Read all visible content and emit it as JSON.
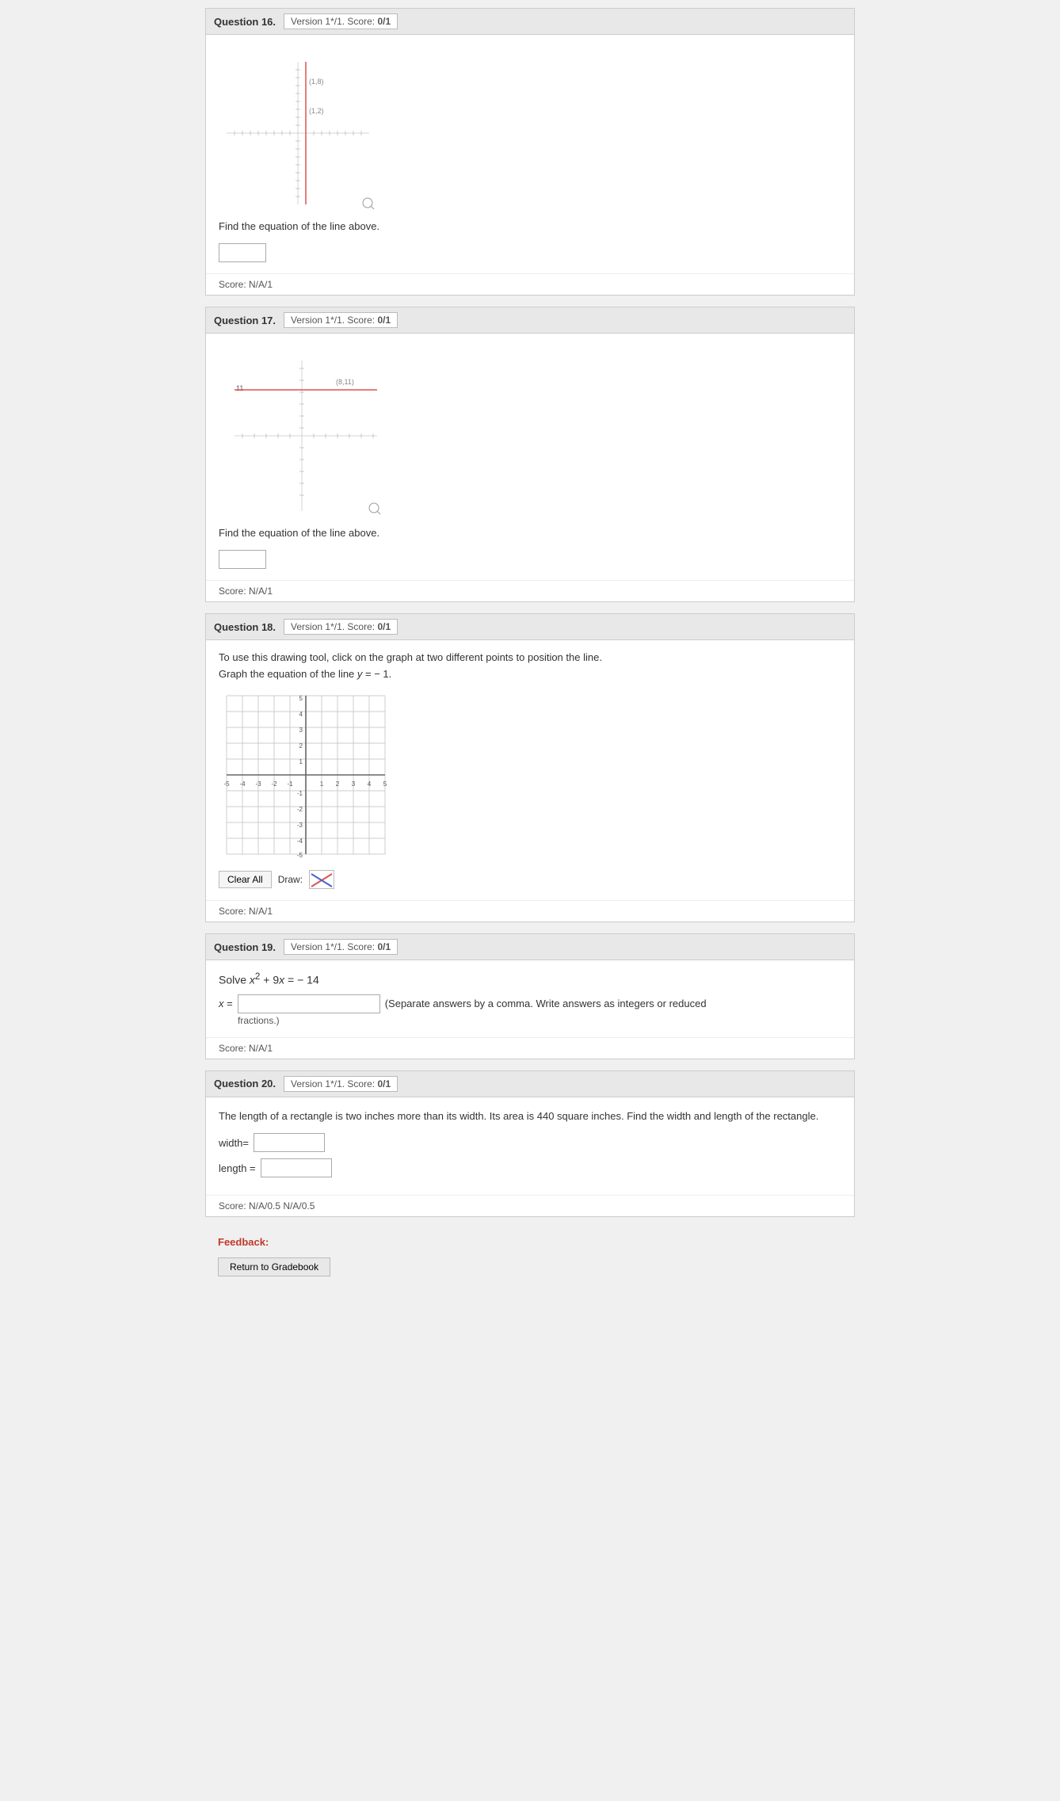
{
  "questions": [
    {
      "id": "q16",
      "number": "Question 16.",
      "version": "Version 1*/1.",
      "score_label": "Score:",
      "score_value": "0/1",
      "type": "find_equation",
      "instruction": "Find the equation of the line above.",
      "graph": {
        "type": "vertical_line",
        "label1": "(1,8)",
        "label2": "(1,2)"
      },
      "footer": "Score: N/A/1"
    },
    {
      "id": "q17",
      "number": "Question 17.",
      "version": "Version 1*/1.",
      "score_label": "Score:",
      "score_value": "0/1",
      "type": "find_equation",
      "instruction": "Find the equation of the line above.",
      "graph": {
        "type": "horizontal_line",
        "label1": "(8,11)",
        "y_label": "11"
      },
      "footer": "Score: N/A/1"
    },
    {
      "id": "q18",
      "number": "Question 18.",
      "version": "Version 1*/1.",
      "score_label": "Score:",
      "score_value": "0/1",
      "type": "graph_equation",
      "tool_instruction": "To use this drawing tool, click on the graph at two different points to position the line.",
      "graph_instruction": "Graph the equation of the line y = − 1.",
      "clear_all_label": "Clear All",
      "draw_label": "Draw:",
      "footer": "Score: N/A/1"
    },
    {
      "id": "q19",
      "number": "Question 19.",
      "version": "Version 1*/1.",
      "score_label": "Score:",
      "score_value": "0/1",
      "type": "solve_equation",
      "equation": "Solve x² + 9x = − 14",
      "x_label": "x =",
      "note": "(Separate answers by a comma. Write answers as integers or reduced fractions.)",
      "footer": "Score: N/A/1"
    },
    {
      "id": "q20",
      "number": "Question 20.",
      "version": "Version 1*/1.",
      "score_label": "Score:",
      "score_value": "0/1",
      "type": "word_problem",
      "problem_text": "The length of a rectangle is two inches more than its width. Its area is 440 square inches. Find the width and length of the rectangle.",
      "width_label": "width=",
      "length_label": "length =",
      "footer": "Score: N/A/0.5 N/A/0.5"
    }
  ],
  "feedback": {
    "label": "Feedback:",
    "return_button": "Return to Gradebook"
  }
}
